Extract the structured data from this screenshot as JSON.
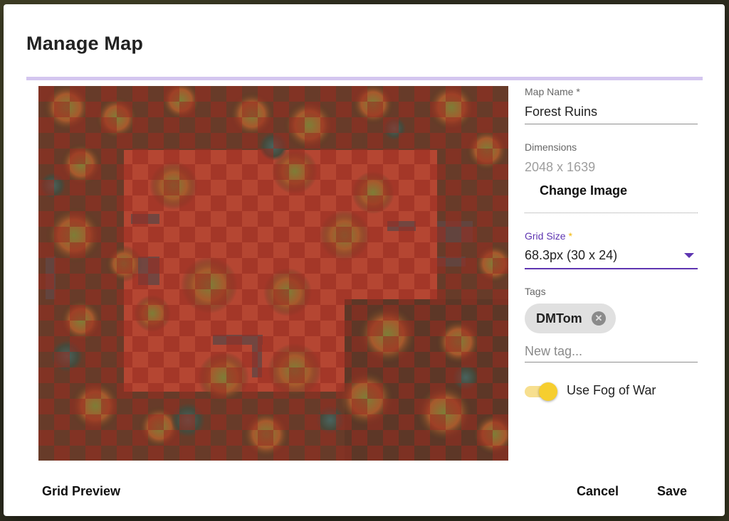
{
  "dialog": {
    "title": "Manage Map",
    "progress_fraction": 1.0
  },
  "form": {
    "map_name": {
      "label": "Map Name *",
      "value": "Forest Ruins"
    },
    "dimensions": {
      "label": "Dimensions",
      "value": "2048 x 1639"
    },
    "change_image_label": "Change Image",
    "grid_size": {
      "label": "Grid Size",
      "required_mark": "*",
      "value": "68.3px (30 x 24)"
    },
    "tags": {
      "label": "Tags",
      "items": [
        {
          "label": "DMTom"
        }
      ],
      "new_tag_placeholder": "New tag..."
    },
    "fog_of_war": {
      "label": "Use Fog of War",
      "checked": true
    }
  },
  "footer": {
    "grid_preview_label": "Grid Preview",
    "cancel_label": "Cancel",
    "save_label": "Save"
  },
  "colors": {
    "accent": "#5e35b1",
    "progress": "#d4c6ef",
    "toggle": "#f6ce2f",
    "grid_overlay": "#c0392b"
  },
  "icons": {
    "dropdown": "arrow-drop-down-icon",
    "chip_remove": "cancel-circle-icon"
  }
}
